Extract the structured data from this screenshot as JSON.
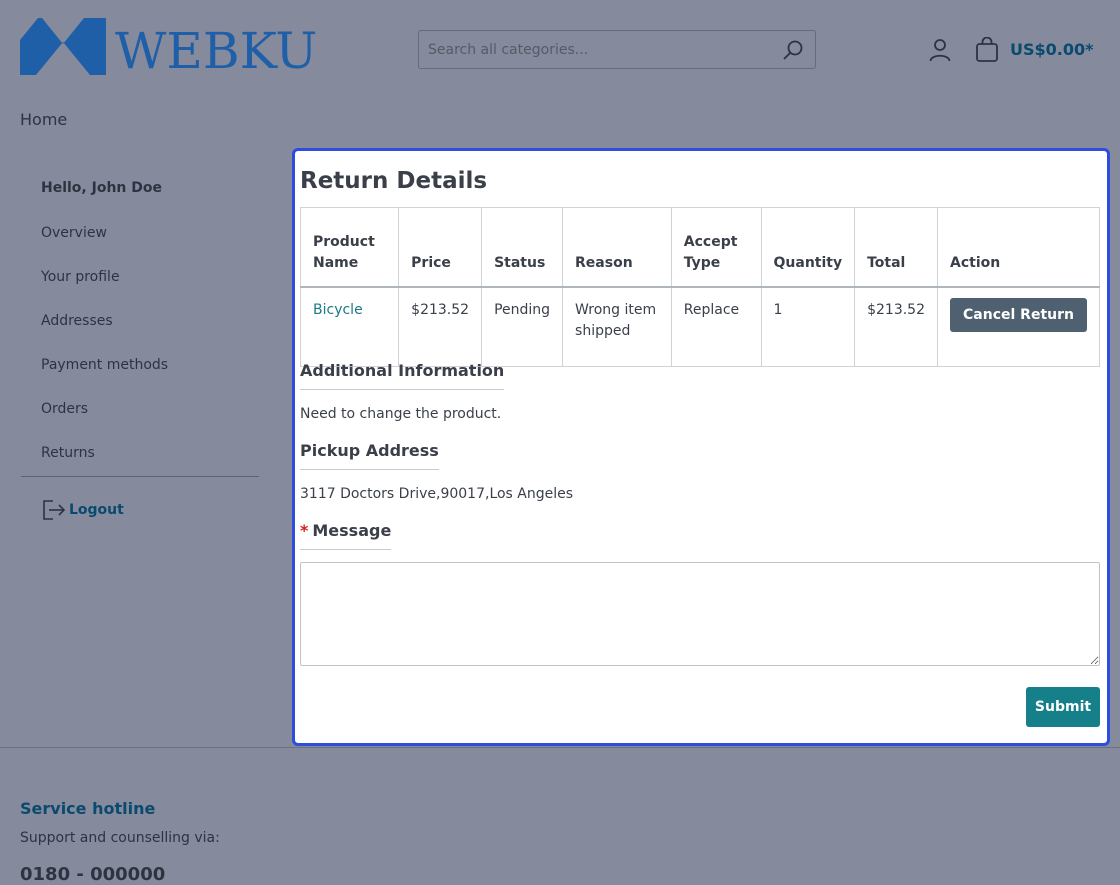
{
  "header": {
    "logo_text": "WEBKUL",
    "search": {
      "placeholder": "Search all categories..."
    },
    "cart_total": "US$0.00*"
  },
  "breadcrumb": {
    "home": "Home"
  },
  "sidebar": {
    "greeting": "Hello, John Doe",
    "items": [
      {
        "label": "Overview"
      },
      {
        "label": "Your profile"
      },
      {
        "label": "Addresses"
      },
      {
        "label": "Payment methods"
      },
      {
        "label": "Orders"
      },
      {
        "label": "Returns"
      }
    ],
    "logout": "Logout"
  },
  "main": {
    "title": "Return Details",
    "table": {
      "headers": {
        "product_name": "Product Name",
        "price": "Price",
        "status": "Status",
        "reason": "Reason",
        "accept_type": "Accept Type",
        "quantity": "Quantity",
        "total": "Total",
        "action": "Action"
      },
      "row": {
        "product_name": "Bicycle",
        "price": "$213.52",
        "status": "Pending",
        "reason": "Wrong item shipped",
        "accept_type": "Replace",
        "quantity": "1",
        "total": "$213.52",
        "action_label": "Cancel Return"
      }
    },
    "additional_information": {
      "title": "Additional Information",
      "text": "Need to change the product."
    },
    "pickup_address": {
      "title": "Pickup Address",
      "text": "3117 Doctors Drive,90017,Los Angeles"
    },
    "message": {
      "required_mark": "*",
      "title": "Message",
      "value": ""
    },
    "submit_label": "Submit"
  },
  "footer": {
    "title": "Service hotline",
    "subtitle": "Support and counselling via:",
    "phone": "0180 - 000000"
  },
  "colors": {
    "accent": "#16808a",
    "link": "#0a4a6e",
    "modal_border": "#2e4de0",
    "overlay": "#858a9c"
  }
}
